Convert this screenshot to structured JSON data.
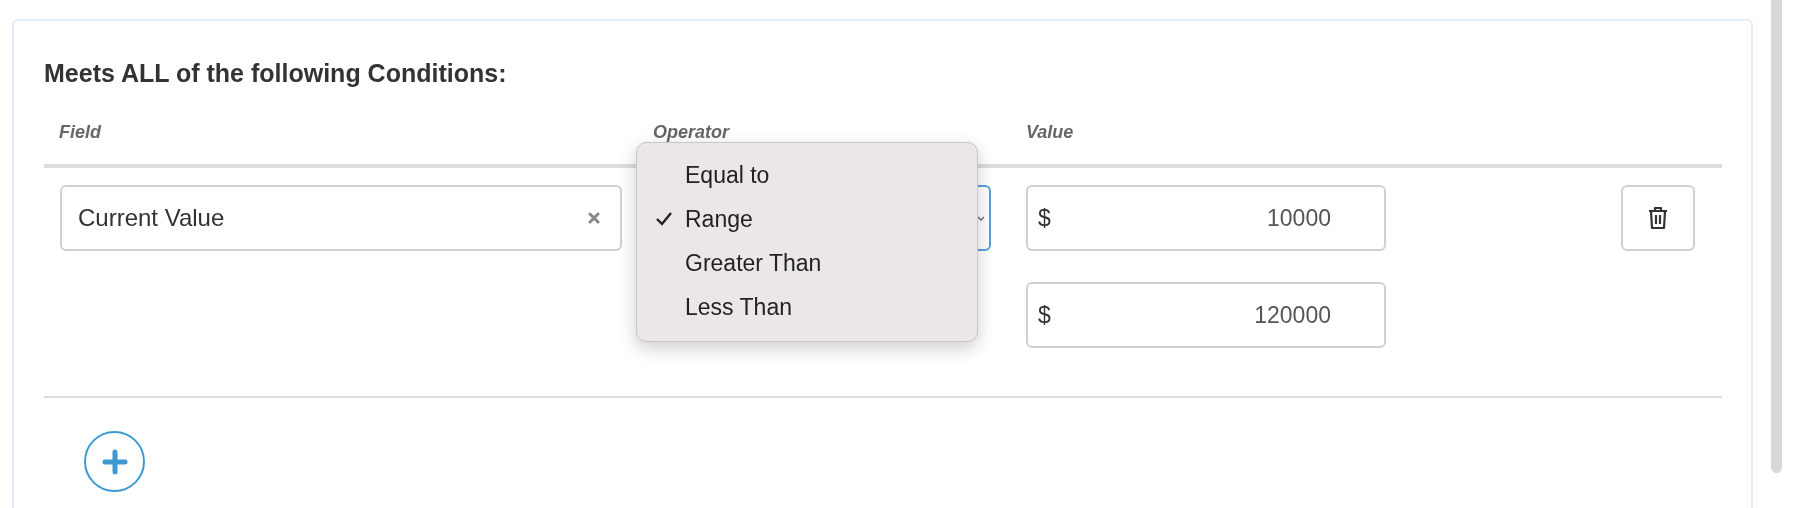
{
  "heading": "Meets ALL of the following Conditions:",
  "columns": [
    "Field",
    "Operator",
    "Value"
  ],
  "conditions": [
    {
      "field": {
        "value": "Current Value"
      },
      "operator": {
        "focused": true
      },
      "values": [
        {
          "prefix": "$",
          "value": "10000"
        },
        {
          "prefix": "$",
          "value": "120000"
        }
      ]
    }
  ],
  "operator_menu": {
    "options": [
      {
        "label": "Equal to",
        "selected": false
      },
      {
        "label": "Range",
        "selected": true
      },
      {
        "label": "Greater Than",
        "selected": false
      },
      {
        "label": "Less Than",
        "selected": false
      }
    ]
  }
}
